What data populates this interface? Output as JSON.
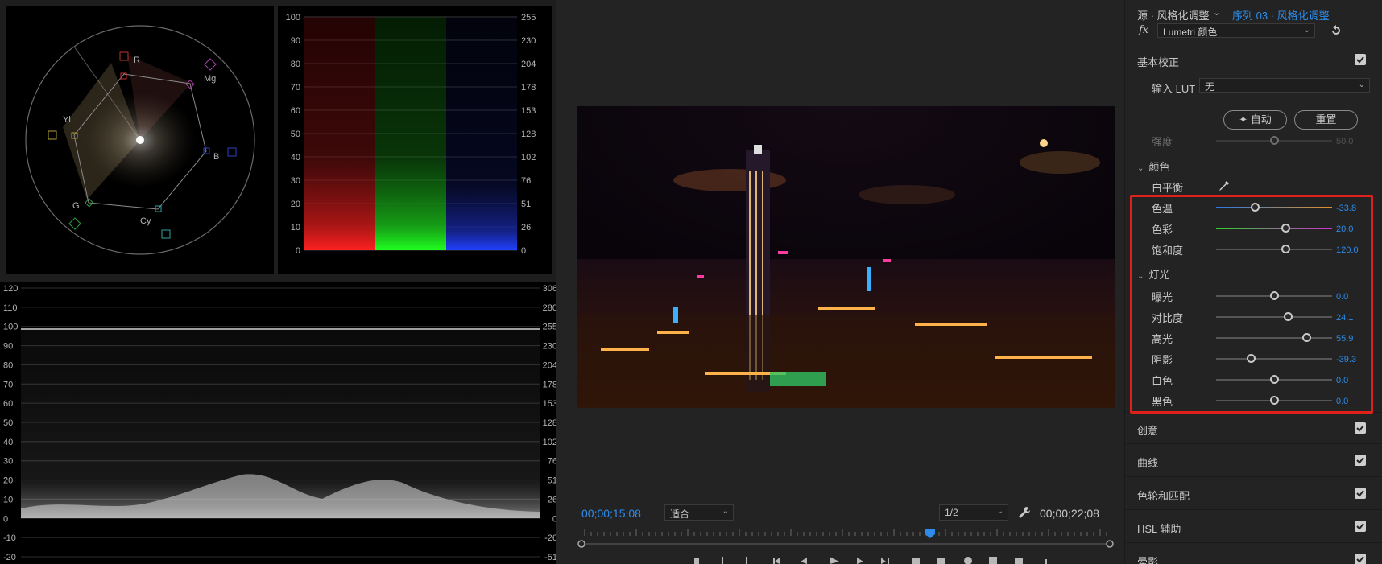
{
  "colors": {
    "accent": "#2d8ceb",
    "highlight": "#e0201a",
    "panel": "#232323",
    "scope_bg": "#000000"
  },
  "vectorscope": {
    "labels": [
      "R",
      "Mg",
      "B",
      "Cy",
      "G",
      "Yl"
    ]
  },
  "parade": {
    "left_ticks": [
      "100",
      "90",
      "80",
      "70",
      "60",
      "50",
      "40",
      "30",
      "20",
      "10",
      "0"
    ],
    "right_ticks": [
      "255",
      "230",
      "204",
      "178",
      "153",
      "128",
      "102",
      "76",
      "51",
      "26",
      "0"
    ]
  },
  "waveform": {
    "left_ticks": [
      "120",
      "110",
      "100",
      "90",
      "80",
      "70",
      "60",
      "50",
      "40",
      "30",
      "20",
      "10",
      "0",
      "-10",
      "-20"
    ],
    "right_ticks": [
      "306",
      "280",
      "255",
      "230",
      "204",
      "178",
      "153",
      "128",
      "102",
      "76",
      "51",
      "26",
      "0",
      "-26",
      "-51"
    ]
  },
  "monitor": {
    "current_time": "00;00;15;08",
    "fit": "适合",
    "resolution": "1/2",
    "duration": "00;00;22;08",
    "playhead_fraction": 0.66
  },
  "lumetri": {
    "source": "源 · 风格化调整",
    "sequence": "序列 03 · 风格化调整",
    "fx": "fx",
    "effect": "Lumetri 颜色",
    "basic": {
      "title": "基本校正",
      "lut_label": "输入 LUT",
      "lut_value": "无",
      "auto_label": "自动",
      "reset_label": "重置",
      "intensity": {
        "label": "强度",
        "value": "50.0",
        "fraction": 0.5
      },
      "color_head": "颜色",
      "white_balance": "白平衡",
      "temperature": {
        "label": "色温",
        "value": "-33.8",
        "fraction": 0.33
      },
      "tint": {
        "label": "色彩",
        "value": "20.0",
        "fraction": 0.6
      },
      "saturation": {
        "label": "饱和度",
        "value": "120.0",
        "fraction": 0.6
      },
      "light_head": "灯光",
      "exposure": {
        "label": "曝光",
        "value": "0.0",
        "fraction": 0.5
      },
      "contrast": {
        "label": "对比度",
        "value": "24.1",
        "fraction": 0.62
      },
      "highlights": {
        "label": "高光",
        "value": "55.9",
        "fraction": 0.78
      },
      "shadows": {
        "label": "阴影",
        "value": "-39.3",
        "fraction": 0.3
      },
      "whites": {
        "label": "白色",
        "value": "0.0",
        "fraction": 0.5
      },
      "blacks": {
        "label": "黑色",
        "value": "0.0",
        "fraction": 0.5
      }
    },
    "sections": [
      "创意",
      "曲线",
      "色轮和匹配",
      "HSL 辅助",
      "晕影"
    ]
  }
}
